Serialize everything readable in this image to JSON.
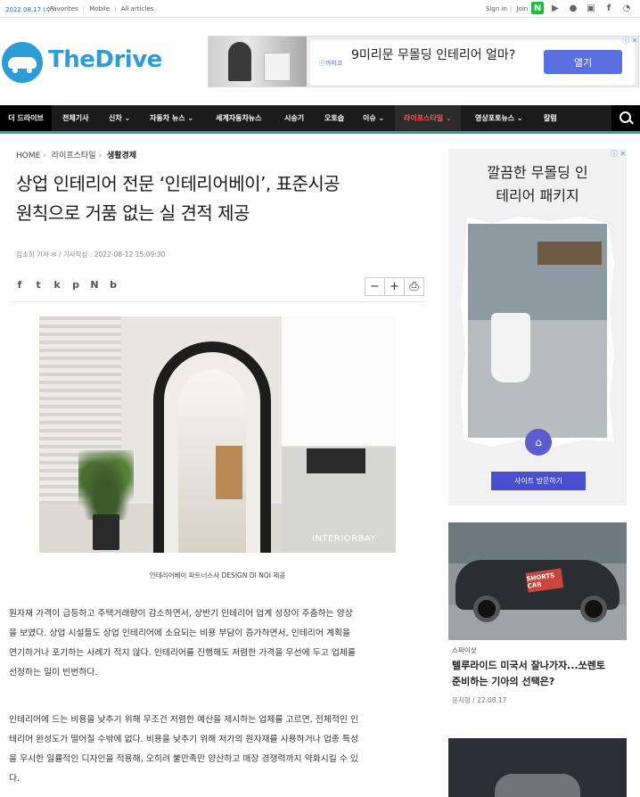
{
  "topbar": {
    "date": "2022.08.17 (수)",
    "links": [
      "Favorites",
      "Mobile",
      "All articles"
    ],
    "signin": "Sign in",
    "join": "Join",
    "social_icons": [
      "naver-icon",
      "play-icon",
      "kakao-icon",
      "youtube-icon",
      "facebook-icon",
      "rss-icon"
    ]
  },
  "logo": {
    "text": "TheDrive"
  },
  "top_ad": {
    "brand": "ⓒ까미코",
    "headline": "9미리문 무몰딩 인테리어 얼마?",
    "cta": "열기",
    "flag": "ⓘ ✕"
  },
  "nav": {
    "home": "더 드라이브",
    "items": [
      {
        "label": "전체기사"
      },
      {
        "label": "신차 ⌄"
      },
      {
        "label": "자동차 뉴스 ⌄"
      },
      {
        "label": "세계자동차뉴스"
      },
      {
        "label": "시승기"
      },
      {
        "label": "오토숍"
      },
      {
        "label": "이슈 ⌄"
      },
      {
        "label": "라이프스타일 ⌄"
      },
      {
        "label": "영상포토뉴스 ⌄"
      },
      {
        "label": "칼럼"
      }
    ]
  },
  "article": {
    "breadcrumb": {
      "home": "HOME",
      "section": "라이프스타일",
      "current": "생활경제"
    },
    "title_line1": "상업 인테리어 전문 ‘인테리어베이’, 표준시공",
    "title_line2": "원칙으로 거품 없는 실 견적 제공",
    "byline": "김소희 기자 ✉ / 기사작성 : 2022-08-12 15:09:30",
    "share_icons": [
      "f",
      "t",
      "k",
      "p",
      "N",
      "b"
    ],
    "tools": [
      "−",
      "+",
      "⎙"
    ],
    "image_watermark": "INTERIORBAY",
    "caption": "인테리어베이 파트너스사 DESIGN DI NOI 제공",
    "p1_l1": "원자재 가격이 급등하고 주택거래량이 감소하면서, 상반기 인테리어 업계 성장이 주춤하는 양상",
    "p1_l2": "을 보였다. 상업 시설들도 상업 인테리어에 소요되는 비용 부담이 증가하면서, 인테리어 계획을",
    "p1_l3": "연기하거나 포기하는 사례가 적지 않다. 인테리어를 진행해도 저렴한 가격을 우선에 두고 업체를",
    "p1_l4": "선정하는 일이 빈번하다.",
    "p2_l1": "인테리어에 드는 비용을 낮추기 위해 무조건 저렴한 예산을 제시하는 업체를 고르면, 전체적인 인",
    "p2_l2": "테리어 완성도가 떨어질 수밖에 없다. 비용을 낮추기 위해 저가의 원자재를 사용하거나 업종 특성",
    "p2_l3": "을 무시한 일률적인 디자인을 적용해, 오히려 불만족만 양산하고 매장 경쟁력까지 약화시킬 수 있",
    "p2_l4": "다."
  },
  "side_ad": {
    "headline_l1": "깔끔한 무몰딩 인",
    "headline_l2": "테리어 패키지",
    "button": "사이트 방문하기",
    "flag": "ⓘ ✕"
  },
  "side_news": {
    "car_tag": "SHORTS CAR",
    "category": "스파이샷",
    "title_l1": "텔루라이드 미국서 잘나가자...쏘렌토",
    "title_l2": "준비하는 기아의 선택은?",
    "meta": "윤지형 / 22.08.17"
  }
}
